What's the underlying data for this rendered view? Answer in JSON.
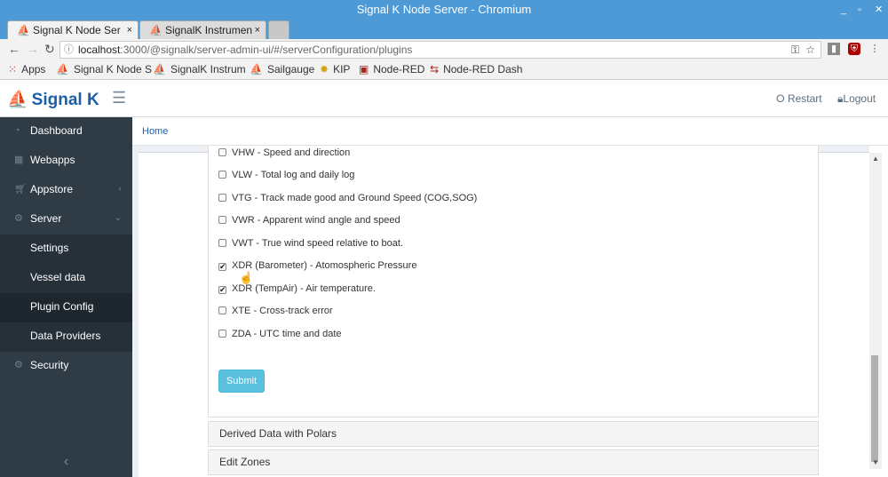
{
  "window": {
    "title": "Signal K Node Server - Chromium",
    "minimize": "_",
    "restore": "▫",
    "close": "✕"
  },
  "tabs": [
    {
      "label": "Signal K Node Ser",
      "close": "×"
    },
    {
      "label": "SignalK Instrumen",
      "close": "×"
    }
  ],
  "address": {
    "host": "localhost",
    "path": ":3000/@signalk/server-admin-ui/#/serverConfiguration/plugins"
  },
  "bookmarks": [
    "Apps",
    "Signal K Node S",
    "SignalK Instrum",
    "Sailgauge",
    "KIP",
    "Node-RED",
    "Node-RED Dash"
  ],
  "app": {
    "brand": "Signal K",
    "restart_label": "Restart",
    "logout_label": "Logout"
  },
  "sidebar": {
    "items": [
      {
        "label": "Dashboard",
        "icon": "dashboard-icon"
      },
      {
        "label": "Webapps",
        "icon": "grid-icon"
      },
      {
        "label": "Appstore",
        "icon": "cart-icon"
      },
      {
        "label": "Server",
        "icon": "gear-icon"
      },
      {
        "label": "Settings"
      },
      {
        "label": "Vessel data"
      },
      {
        "label": "Plugin Config"
      },
      {
        "label": "Data Providers"
      },
      {
        "label": "Security",
        "icon": "gear-icon"
      }
    ]
  },
  "breadcrumb": "Home",
  "sentences": [
    {
      "label": "VHW - Speed and direction",
      "checked": false
    },
    {
      "label": "VLW - Total log and daily log",
      "checked": false
    },
    {
      "label": "VTG - Track made good and Ground Speed (COG,SOG)",
      "checked": false
    },
    {
      "label": "VWR - Apparent wind angle and speed",
      "checked": false
    },
    {
      "label": "VWT - True wind speed relative to boat.",
      "checked": false
    },
    {
      "label": "XDR (Barometer) - Atomospheric Pressure",
      "checked": true
    },
    {
      "label": "XDR (TempAir) - Air temperature.",
      "checked": true
    },
    {
      "label": "XTE - Cross-track error",
      "checked": false
    },
    {
      "label": "ZDA - UTC time and date",
      "checked": false
    }
  ],
  "submit_label": "Submit",
  "accordions": [
    "Derived Data with Polars",
    "Edit Zones"
  ],
  "colors": {
    "accent": "#1a5fa8",
    "sidebar": "#2f3b45",
    "submit": "#5bc0de",
    "titlebar": "#4d9ad6"
  }
}
